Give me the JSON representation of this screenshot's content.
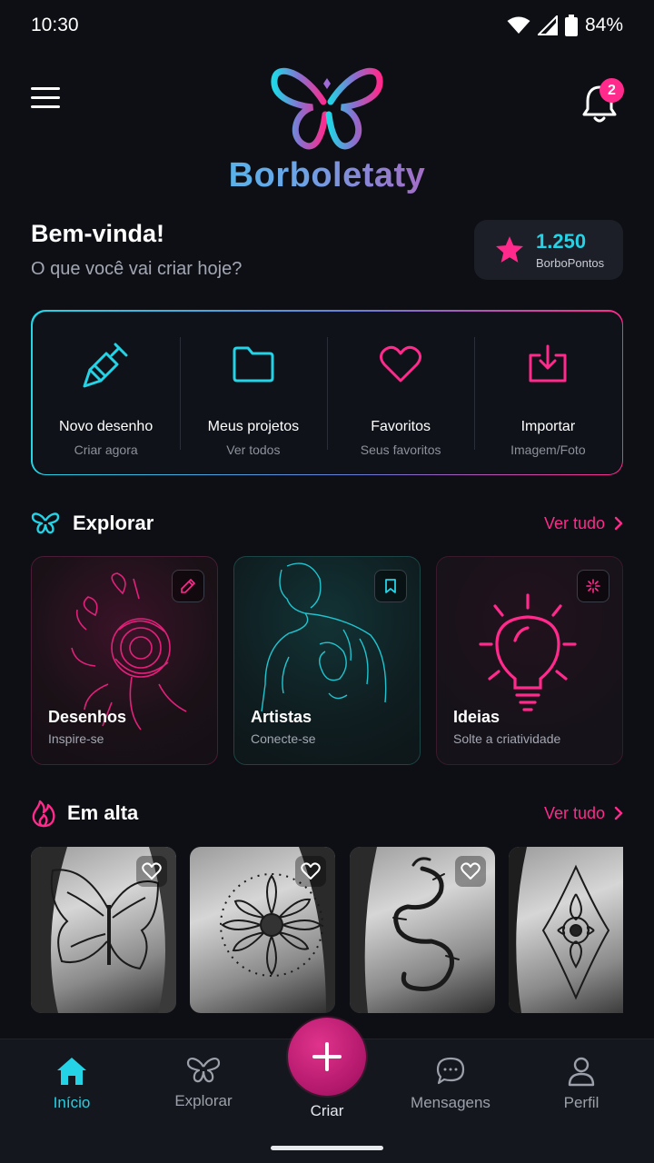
{
  "status": {
    "time": "10:30",
    "battery": "84%"
  },
  "header": {
    "app_name": "Borboletaty",
    "notification_count": "2",
    "icons": [
      "menu-icon",
      "butterfly-logo",
      "bell-icon"
    ]
  },
  "welcome": {
    "title": "Bem-vinda!",
    "subtitle": "O que você vai criar hoje?"
  },
  "points": {
    "value": "1.250",
    "label": "BorboPontos"
  },
  "quick_actions": [
    {
      "title": "Novo desenho",
      "subtitle": "Criar agora",
      "icon": "tattoo-pen-icon"
    },
    {
      "title": "Meus projetos",
      "subtitle": "Ver todos",
      "icon": "folder-icon"
    },
    {
      "title": "Favoritos",
      "subtitle": "Seus favoritos",
      "icon": "heart-icon"
    },
    {
      "title": "Importar",
      "subtitle": "Imagem/Foto",
      "icon": "import-icon"
    }
  ],
  "explore": {
    "title": "Explorar",
    "see_all": "Ver tudo",
    "cards": [
      {
        "title": "Desenhos",
        "subtitle": "Inspire-se",
        "icon": "pen-icon"
      },
      {
        "title": "Artistas",
        "subtitle": "Conecte-se",
        "icon": "bookmark-icon"
      },
      {
        "title": "Ideias",
        "subtitle": "Solte a criatividade",
        "icon": "sparkle-icon"
      }
    ]
  },
  "trending": {
    "title": "Em alta",
    "see_all": "Ver tudo",
    "items": [
      "butterfly-tattoo",
      "flower-tattoo",
      "dragon-tattoo",
      "mandala-tattoo"
    ]
  },
  "nav": {
    "items": [
      {
        "label": "Início",
        "icon": "home-icon",
        "active": true
      },
      {
        "label": "Explorar",
        "icon": "butterfly-icon",
        "active": false
      },
      {
        "label": "Criar",
        "icon": "plus-icon",
        "active": false
      },
      {
        "label": "Mensagens",
        "icon": "chat-icon",
        "active": false
      },
      {
        "label": "Perfil",
        "icon": "user-icon",
        "active": false
      }
    ]
  },
  "colors": {
    "accent_cyan": "#24d3e6",
    "accent_pink": "#ff2a8c",
    "background": "#0d0f14"
  }
}
